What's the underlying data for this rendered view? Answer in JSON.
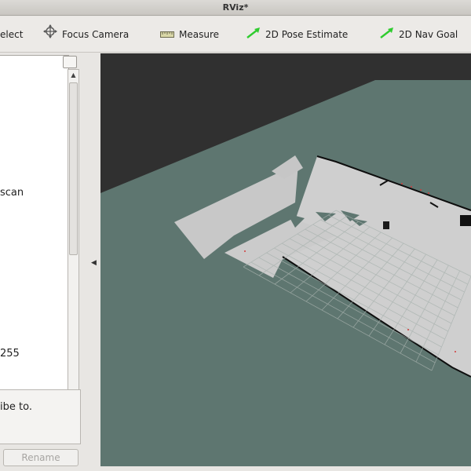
{
  "window": {
    "title": "RViz*"
  },
  "toolbar": {
    "items": [
      {
        "label": "elect",
        "icon": "select-cursor-icon"
      },
      {
        "label": "Focus Camera",
        "icon": "focus-camera-icon"
      },
      {
        "label": "Measure",
        "icon": "measure-icon"
      },
      {
        "label": "2D Pose Estimate",
        "icon": "green-arrow-icon"
      },
      {
        "label": "2D Nav Goal",
        "icon": "green-arrow-icon"
      }
    ]
  },
  "left_panel": {
    "tree_lines": [
      "scan",
      "255"
    ],
    "description": "ibe to.",
    "rename_label": "Rename"
  },
  "colors": {
    "background": "#303030",
    "ground": "#5e7670",
    "map_free": "#cfcfcf",
    "grid": "#a8b2ae",
    "nav_arrow": "#2fcc2f"
  }
}
